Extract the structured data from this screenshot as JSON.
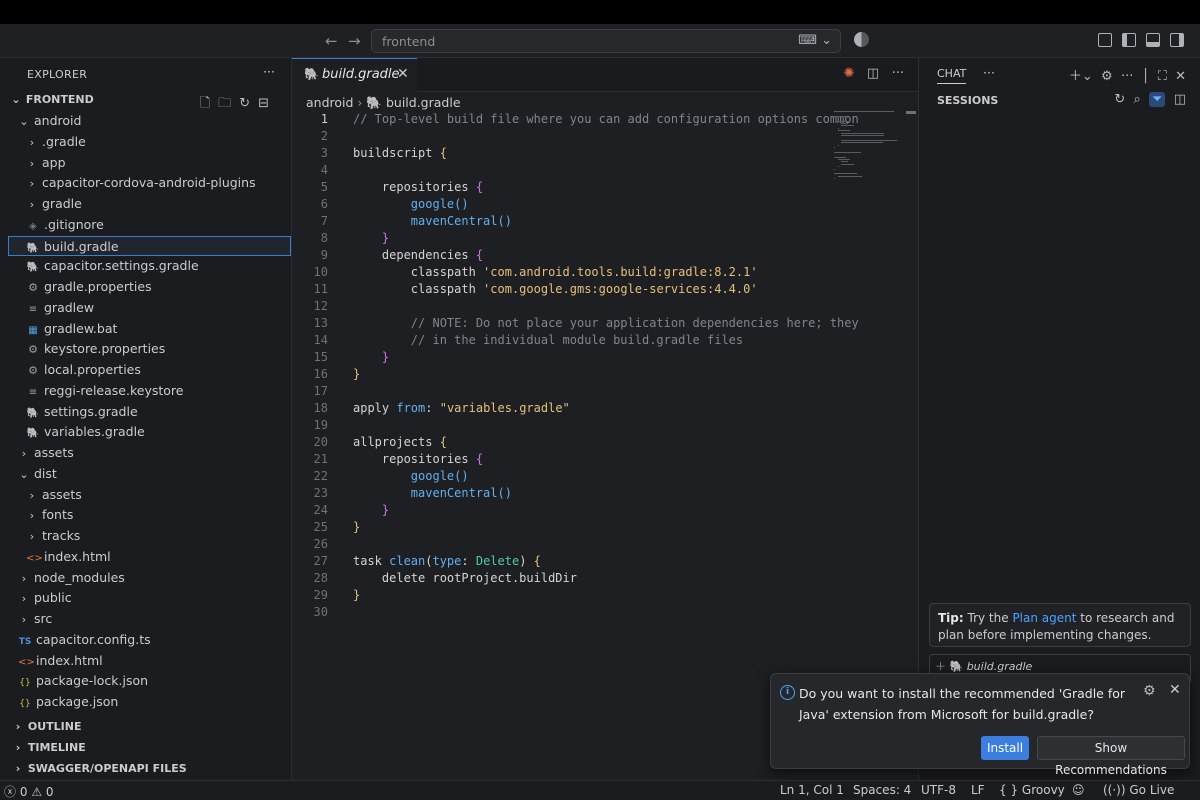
{
  "titlebar": {
    "search_text": "frontend",
    "icons": [
      "arrow-left-icon",
      "arrow-right-icon",
      "chat-icon",
      "chevron-down-icon",
      "layout-icons"
    ]
  },
  "explorer": {
    "header": "EXPLORER",
    "root": "FRONTEND",
    "items": [
      {
        "label": "android",
        "depth": 1,
        "kind": "folder-open"
      },
      {
        "label": ".gradle",
        "depth": 2,
        "kind": "folder"
      },
      {
        "label": "app",
        "depth": 2,
        "kind": "folder"
      },
      {
        "label": "capacitor-cordova-android-plugins",
        "depth": 2,
        "kind": "folder"
      },
      {
        "label": "gradle",
        "depth": 2,
        "kind": "folder"
      },
      {
        "label": ".gitignore",
        "depth": 2,
        "kind": "dot"
      },
      {
        "label": "build.gradle",
        "depth": 2,
        "kind": "gradle",
        "selected": true
      },
      {
        "label": "capacitor.settings.gradle",
        "depth": 2,
        "kind": "gradle"
      },
      {
        "label": "gradle.properties",
        "depth": 2,
        "kind": "gear"
      },
      {
        "label": "gradlew",
        "depth": 2,
        "kind": "lines"
      },
      {
        "label": "gradlew.bat",
        "depth": 2,
        "kind": "win"
      },
      {
        "label": "keystore.properties",
        "depth": 2,
        "kind": "gear"
      },
      {
        "label": "local.properties",
        "depth": 2,
        "kind": "gear"
      },
      {
        "label": "reggi-release.keystore",
        "depth": 2,
        "kind": "lines"
      },
      {
        "label": "settings.gradle",
        "depth": 2,
        "kind": "gradle"
      },
      {
        "label": "variables.gradle",
        "depth": 2,
        "kind": "gradle"
      },
      {
        "label": "assets",
        "depth": 1,
        "kind": "folder"
      },
      {
        "label": "dist",
        "depth": 1,
        "kind": "folder-open"
      },
      {
        "label": "assets",
        "depth": 2,
        "kind": "folder"
      },
      {
        "label": "fonts",
        "depth": 2,
        "kind": "folder"
      },
      {
        "label": "tracks",
        "depth": 2,
        "kind": "folder"
      },
      {
        "label": "index.html",
        "depth": 2,
        "kind": "html"
      },
      {
        "label": "node_modules",
        "depth": 1,
        "kind": "folder"
      },
      {
        "label": "public",
        "depth": 1,
        "kind": "folder"
      },
      {
        "label": "src",
        "depth": 1,
        "kind": "folder"
      },
      {
        "label": "capacitor.config.ts",
        "depth": 1,
        "kind": "ts"
      },
      {
        "label": "index.html",
        "depth": 1,
        "kind": "html"
      },
      {
        "label": "package-lock.json",
        "depth": 1,
        "kind": "json"
      },
      {
        "label": "package.json",
        "depth": 1,
        "kind": "json"
      }
    ],
    "sections": [
      "OUTLINE",
      "TIMELINE",
      "SWAGGER/OPENAPI FILES"
    ]
  },
  "editor": {
    "tab_label": "build.gradle",
    "breadcrumb": [
      "android",
      "build.gradle"
    ],
    "active_line": 1,
    "lines": [
      [
        [
          "comment",
          "// Top-level build file where you can add configuration options common"
        ]
      ],
      [],
      [
        [
          "plain",
          "buildscript "
        ],
        [
          "brace",
          "{"
        ]
      ],
      [],
      [
        [
          "plain",
          "    repositories "
        ],
        [
          "brace2",
          "{"
        ]
      ],
      [
        [
          "fn",
          "        google()"
        ]
      ],
      [
        [
          "fn",
          "        mavenCentral()"
        ]
      ],
      [
        [
          "brace2",
          "    }"
        ]
      ],
      [
        [
          "plain",
          "    dependencies "
        ],
        [
          "brace2",
          "{"
        ]
      ],
      [
        [
          "plain",
          "        classpath "
        ],
        [
          "str",
          "'com.android.tools.build:gradle:8.2.1'"
        ]
      ],
      [
        [
          "plain",
          "        classpath "
        ],
        [
          "str",
          "'com.google.gms:google-services:4.4.0'"
        ]
      ],
      [],
      [
        [
          "comment",
          "        // NOTE: Do not place your application dependencies here; they"
        ]
      ],
      [
        [
          "comment",
          "        // in the individual module build.gradle files"
        ]
      ],
      [
        [
          "brace2",
          "    }"
        ]
      ],
      [
        [
          "brace",
          "}"
        ]
      ],
      [],
      [
        [
          "plain",
          "apply "
        ],
        [
          "fn",
          "from"
        ],
        [
          "plain",
          ": "
        ],
        [
          "str",
          "\"variables.gradle\""
        ]
      ],
      [],
      [
        [
          "plain",
          "allprojects "
        ],
        [
          "brace",
          "{"
        ]
      ],
      [
        [
          "plain",
          "    repositories "
        ],
        [
          "brace2",
          "{"
        ]
      ],
      [
        [
          "fn",
          "        google()"
        ]
      ],
      [
        [
          "fn",
          "        mavenCentral()"
        ]
      ],
      [
        [
          "brace2",
          "    }"
        ]
      ],
      [
        [
          "brace",
          "}"
        ]
      ],
      [],
      [
        [
          "plain",
          "task "
        ],
        [
          "fn",
          "clean"
        ],
        [
          "plain",
          "("
        ],
        [
          "fn",
          "type"
        ],
        [
          "plain",
          ": "
        ],
        [
          "type",
          "Delete"
        ],
        [
          "plain",
          ") "
        ],
        [
          "brace",
          "{"
        ]
      ],
      [
        [
          "plain",
          "    delete rootProject.buildDir"
        ]
      ],
      [
        [
          "brace",
          "}"
        ]
      ],
      []
    ]
  },
  "chat": {
    "title": "CHAT",
    "sessions_label": "SESSIONS",
    "tip_bold": "Tip:",
    "tip_pre": " Try the ",
    "tip_link": "Plan agent",
    "tip_post": " to research and plan before implementing changes.",
    "context_file": "build.gradle"
  },
  "toast": {
    "message": "Do you want to install the recommended 'Gradle for Java' extension from Microsoft for build.gradle?",
    "install_label": "Install",
    "recommendations_label": "Show Recommendations"
  },
  "statusbar": {
    "errors": "0",
    "warnings": "0",
    "position": "Ln 1, Col 1",
    "spaces": "Spaces: 4",
    "encoding": "UTF-8",
    "eol": "LF",
    "language": "Groovy",
    "golive": "Go Live"
  },
  "colors": {
    "accent": "#3b7ee0",
    "selection_border": "#3a7bd5",
    "string": "#e5c07b",
    "function": "#61afef"
  }
}
